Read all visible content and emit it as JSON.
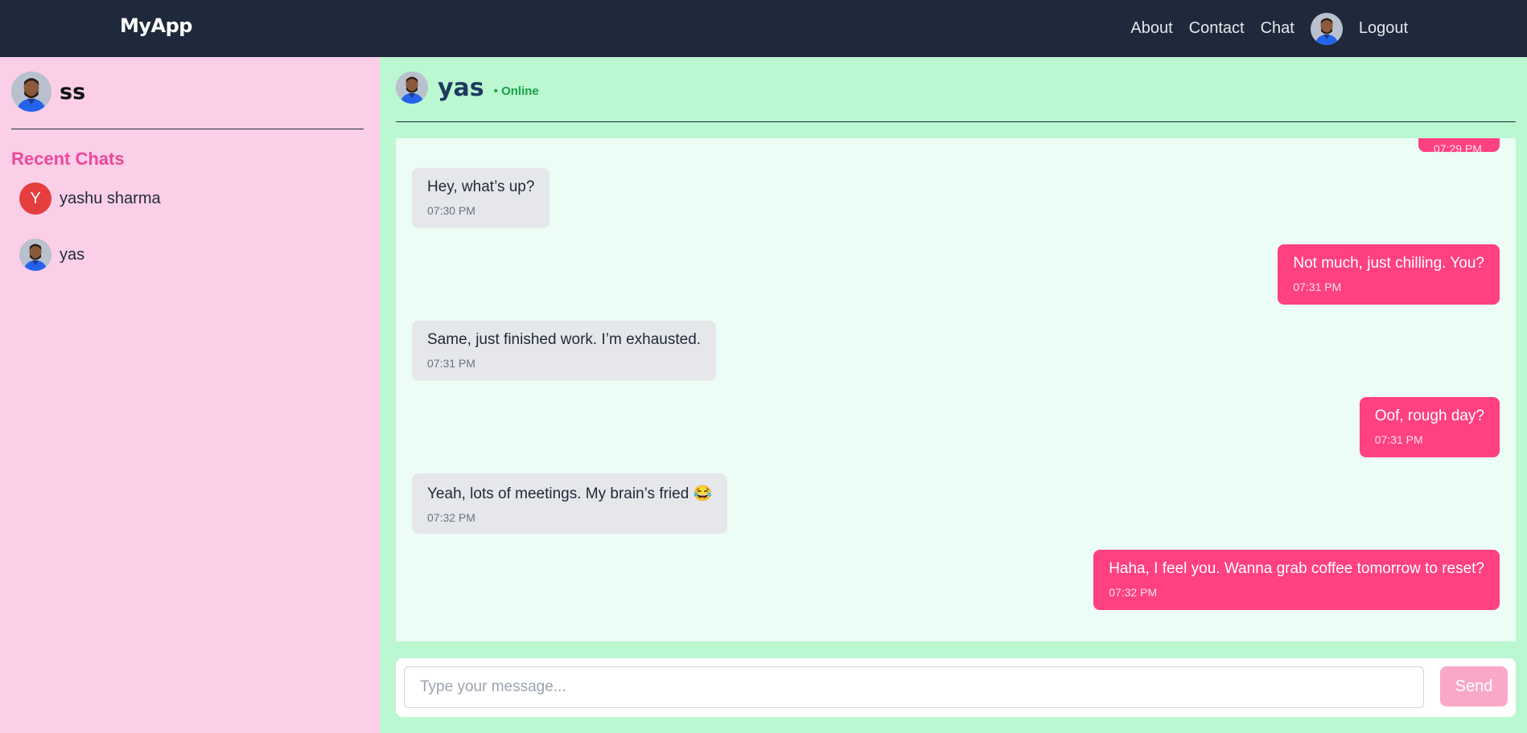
{
  "navbar": {
    "brand": "MyApp",
    "links": [
      "About",
      "Contact",
      "Chat"
    ],
    "logout": "Logout"
  },
  "sidebar": {
    "user_name": "ss",
    "recent_title": "Recent Chats",
    "chats": [
      {
        "initial": "Y",
        "name": "yashu sharma",
        "avatar": "initial"
      },
      {
        "name": "yas",
        "avatar": "photo"
      }
    ]
  },
  "chat": {
    "contact_name": "yas",
    "status": "• Online",
    "messages": [
      {
        "dir": "out",
        "text": "",
        "time": "07:29 PM"
      },
      {
        "dir": "in",
        "text": "Hey, what’s up?",
        "time": "07:30 PM"
      },
      {
        "dir": "out",
        "text": "Not much, just chilling. You?",
        "time": "07:31 PM"
      },
      {
        "dir": "in",
        "text": "Same, just finished work. I’m exhausted.",
        "time": "07:31 PM"
      },
      {
        "dir": "out",
        "text": "Oof, rough day?",
        "time": "07:31 PM"
      },
      {
        "dir": "in",
        "text": "Yeah, lots of meetings. My brain’s fried 😂",
        "time": "07:32 PM"
      },
      {
        "dir": "out",
        "text": "Haha, I feel you. Wanna grab coffee tomorrow to reset?",
        "time": "07:32 PM"
      }
    ]
  },
  "composer": {
    "placeholder": "Type your message...",
    "send_label": "Send"
  },
  "colors": {
    "navbar": "#1e293b",
    "sidebar": "#fbcfe8",
    "chat_bg": "#bbf7d0",
    "accent": "#ff4081",
    "online": "#16a34a"
  }
}
